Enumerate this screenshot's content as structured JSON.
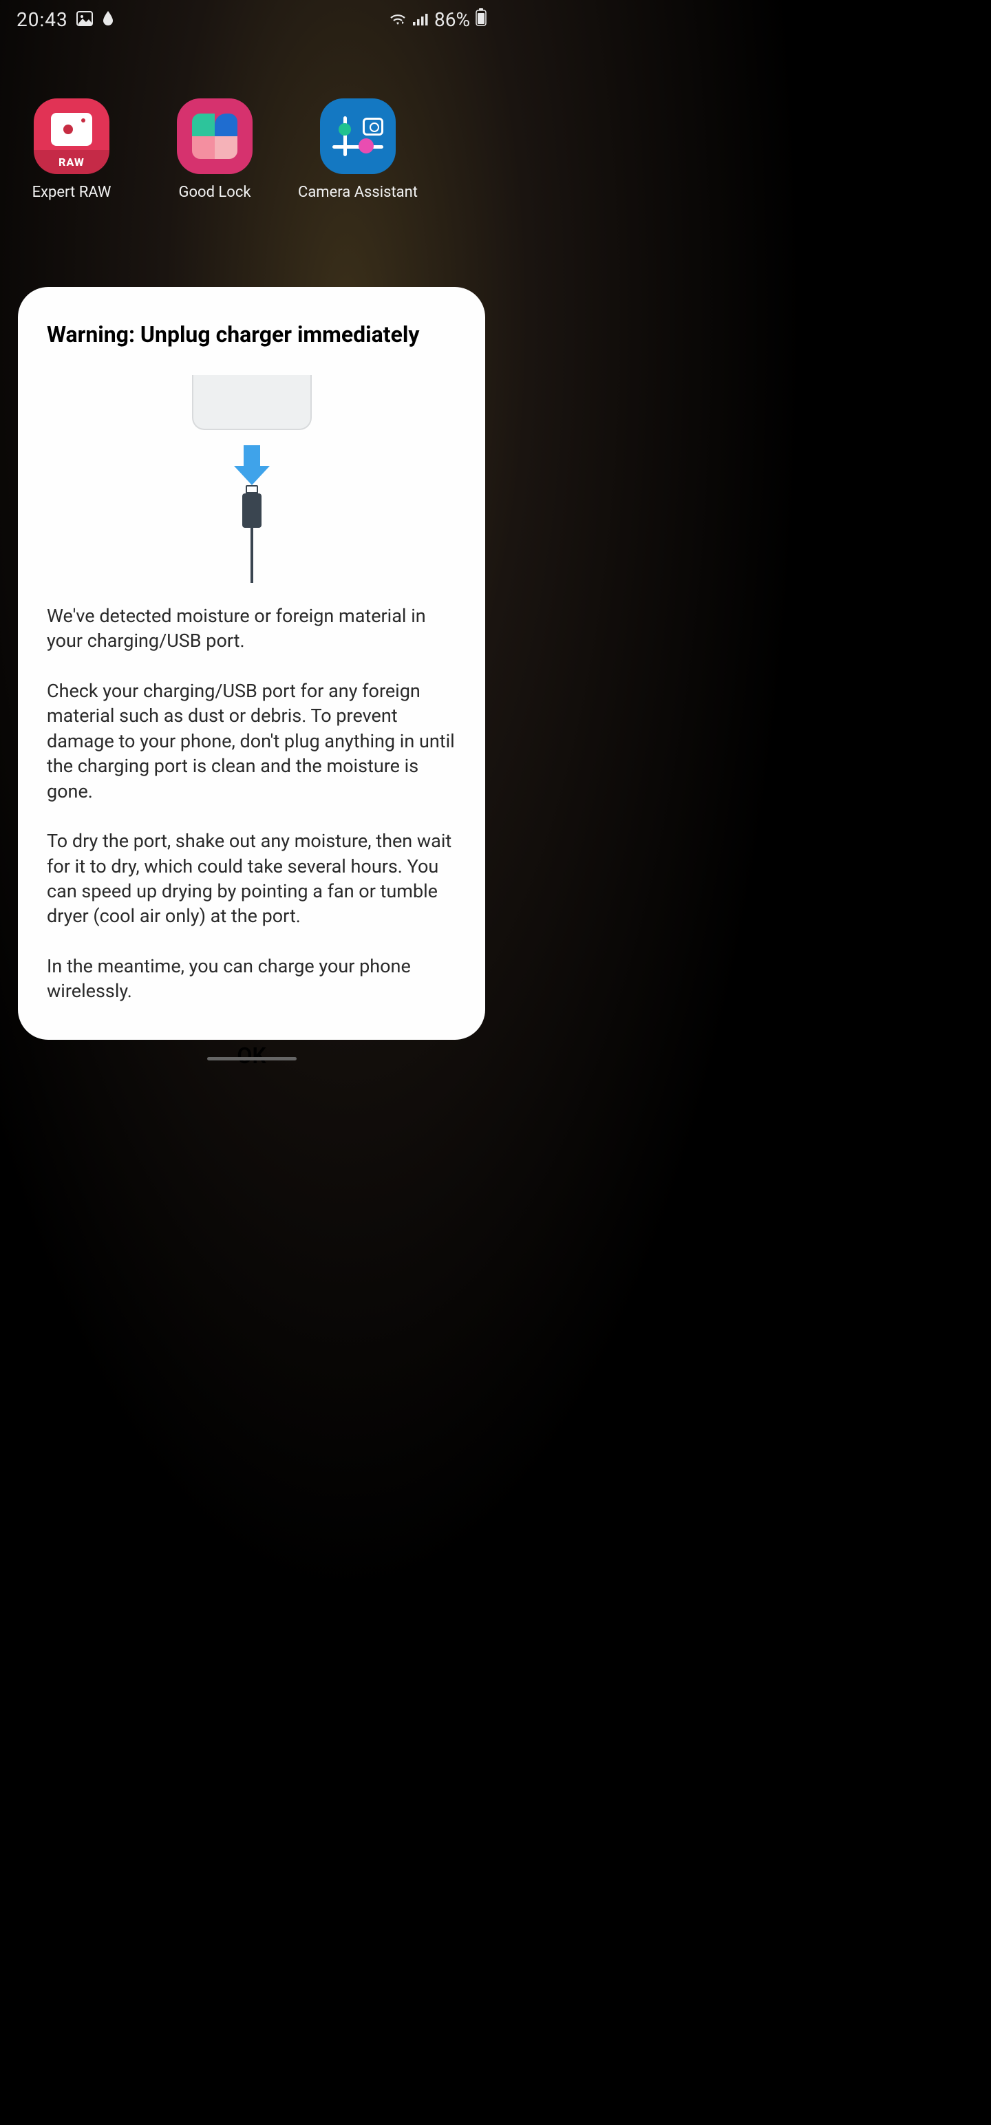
{
  "statusbar": {
    "time": "20:43",
    "battery_pct": "86%"
  },
  "apps": [
    {
      "name": "Expert RAW",
      "raw_badge": "RAW"
    },
    {
      "name": "Good Lock"
    },
    {
      "name": "Camera Assistant"
    }
  ],
  "dialog": {
    "title": "Warning: Unplug charger immediately",
    "p1": "We've detected moisture or foreign material in your charging/USB port.",
    "p2": "Check your charging/USB port for any foreign material such as dust or debris. To prevent damage to your phone, don't plug anything in until the charging port is clean and the moisture is gone.",
    "p3": "To dry the port, shake out any moisture, then wait for it to dry, which could take several hours. You can speed up drying by pointing a fan or tumble dryer (cool air only) at the port.",
    "p4": "In the meantime, you can charge your phone wirelessly.",
    "ok": "OK"
  }
}
